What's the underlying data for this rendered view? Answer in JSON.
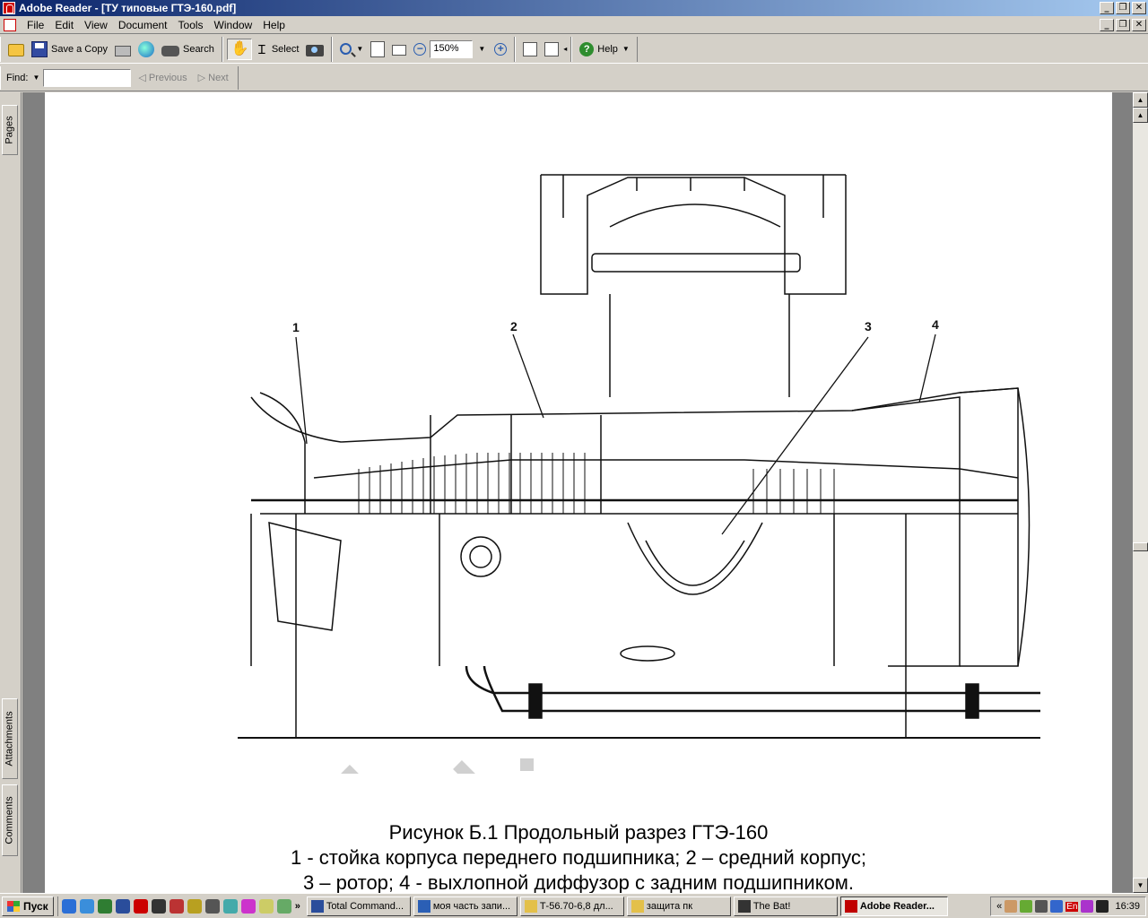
{
  "window": {
    "title": "Adobe Reader - [ТУ типовые ГТЭ-160.pdf]",
    "minimize": "_",
    "restore": "❐",
    "close": "✕"
  },
  "menu": {
    "items": [
      "File",
      "Edit",
      "View",
      "Document",
      "Tools",
      "Window",
      "Help"
    ]
  },
  "toolbar": {
    "save_copy": "Save a Copy",
    "search": "Search",
    "select": "Select",
    "zoom_value": "150%",
    "help": "Help"
  },
  "findbar": {
    "find_label": "Find:",
    "find_value": "",
    "previous": "Previous",
    "next": "Next"
  },
  "side_tabs": {
    "pages": "Pages",
    "attachments": "Attachments",
    "comments": "Comments"
  },
  "document": {
    "callouts": [
      "1",
      "2",
      "3",
      "4"
    ],
    "caption_line1": "Рисунок Б.1  Продольный разрез ГТЭ-160",
    "caption_line2": "1 - стойка корпуса переднего подшипника; 2 – средний корпус;",
    "caption_line3": "3 – ротор; 4 - выхлопной диффузор с задним подшипником."
  },
  "taskbar": {
    "start": "Пуск",
    "overflow": "»",
    "tasks": [
      {
        "label": "Total Command...",
        "color": "#2a4d9b"
      },
      {
        "label": "моя часть запи...",
        "color": "#2b5fb5"
      },
      {
        "label": "Т-56.70-6,8 дл...",
        "color": "#e3c04a"
      },
      {
        "label": "защита пк",
        "color": "#e3c04a"
      },
      {
        "label": "The Bat!",
        "color": "#333333"
      },
      {
        "label": "Adobe Reader...",
        "color": "#c00000"
      }
    ],
    "tray_chevron": "«",
    "lang": "En",
    "clock": "16:39"
  }
}
